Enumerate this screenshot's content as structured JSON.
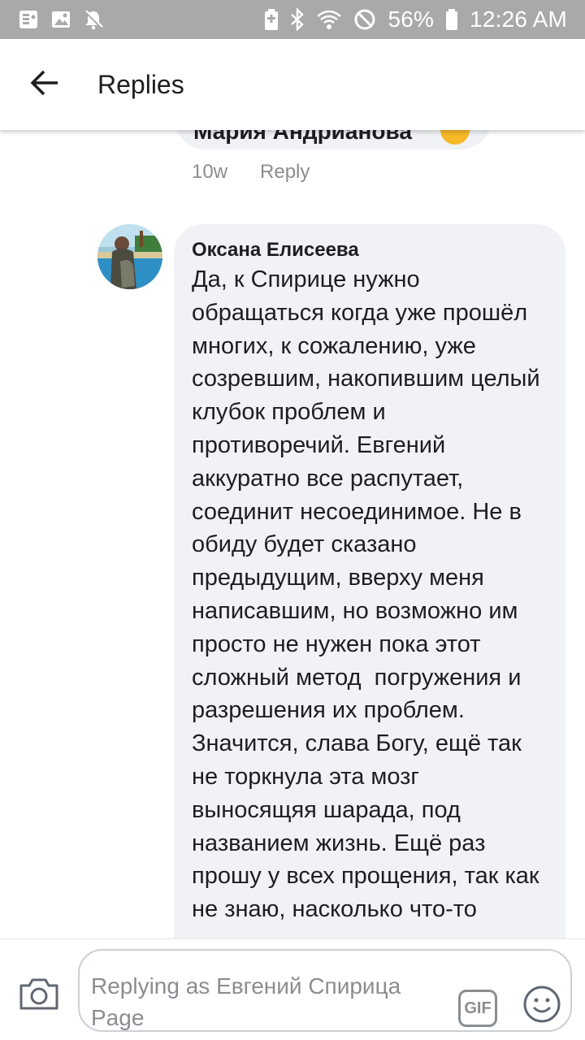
{
  "status_bar": {
    "battery_percent": "56%",
    "time": "12:26 AM",
    "left_icons": [
      "contact-card-icon",
      "image-icon",
      "notifications-off-icon"
    ],
    "right_icons": [
      "battery-saver-icon",
      "bluetooth-icon",
      "wifi-icon",
      "do-not-disturb-icon",
      "battery-icon"
    ]
  },
  "header": {
    "title": "Replies",
    "back_icon": "arrow-left-icon"
  },
  "previous_comment": {
    "author_partial": "Мария Андрианова",
    "age": "10w",
    "reply_label": "Reply"
  },
  "comment": {
    "author": "Оксана Елисеева",
    "text": "Да, к Спирице нужно обращаться когда уже прошёл многих, к сожалению, уже созревшим, накопившим целый клубок проблем и противоречий. Евгений аккуратно все распутает, соединит несоединимое. Не в обиду будет сказано предыдущим, вверху меня написавшим, но возможно им просто не нужен пока этот сложный метод  погружения и разрешения их проблем. Значится, слава Богу, ещё так не торкнула эта мозг выносящяя шарада, под названием жизнь. Ещё раз прошу у всех прощения, так как не знаю, насколько что-то"
  },
  "composer": {
    "placeholder": "Replying as Евгений Спирица Page",
    "gif_label": "GIF",
    "camera_icon": "camera-icon",
    "emoji_icon": "emoji-icon"
  },
  "colors": {
    "status_bar_bg": "#a9a9a9",
    "bubble_bg": "#f0f2f5",
    "text_primary": "#1c1e21",
    "text_secondary": "#8a8d91"
  }
}
